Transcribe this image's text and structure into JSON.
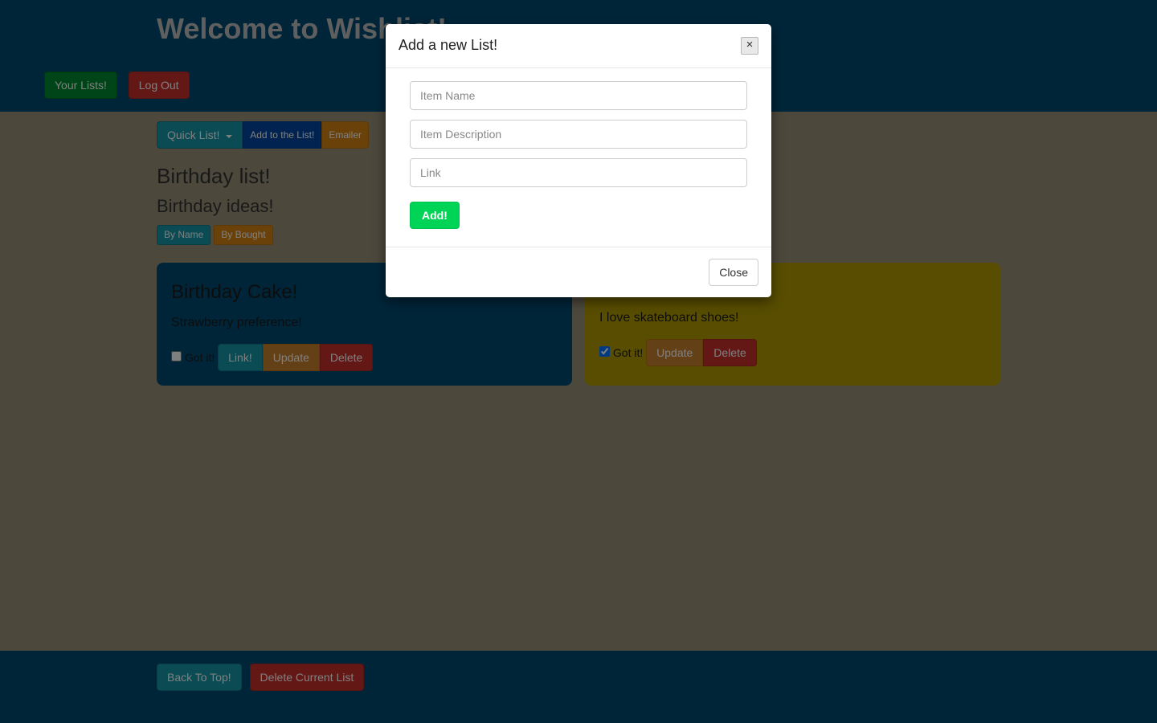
{
  "header": {
    "title": "Welcome to Wishlist!",
    "your_lists": "Your Lists!",
    "log_out": "Log Out"
  },
  "toolbar": {
    "quick_list": "Quick List!",
    "add_to_list": "Add to the List!",
    "emailer": "Emailer"
  },
  "list": {
    "title": "Birthday list!",
    "subtitle": "Birthday ideas!"
  },
  "sorts": {
    "by_name": "By Name",
    "by_bought": "By Bought"
  },
  "cards": [
    {
      "title": "Birthday Cake!",
      "description": "Strawberry preference!",
      "got_it_label": "Got it!",
      "got_it_checked": false,
      "has_link": true,
      "link_label": "Link!",
      "update_label": "Update",
      "delete_label": "Delete"
    },
    {
      "title": "",
      "description": "I love skateboard shoes!",
      "got_it_label": "Got it!",
      "got_it_checked": true,
      "has_link": false,
      "update_label": "Update",
      "delete_label": "Delete"
    }
  ],
  "footer": {
    "back_to_top": "Back To Top!",
    "delete_current": "Delete Current List"
  },
  "modal": {
    "title": "Add a new List!",
    "close_x": "×",
    "item_name_ph": "Item Name",
    "item_desc_ph": "Item Description",
    "link_ph": "Link",
    "add_label": "Add!",
    "close_label": "Close"
  }
}
